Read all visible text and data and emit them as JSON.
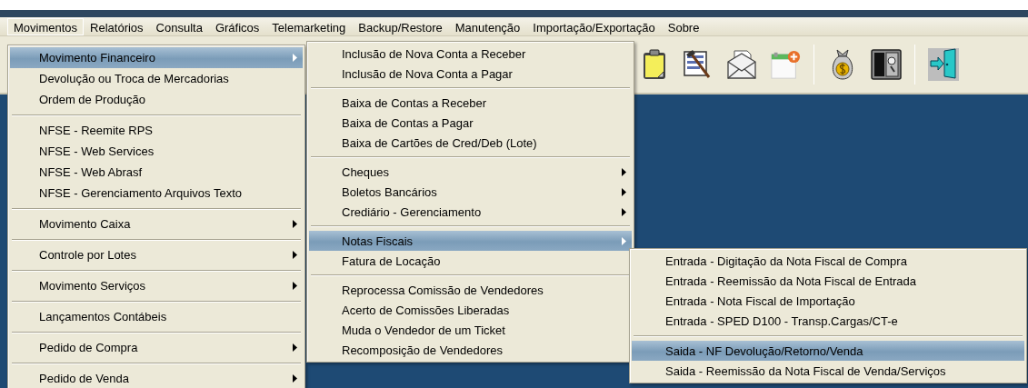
{
  "menubar": [
    {
      "label": "Movimentos",
      "selected": true
    },
    {
      "label": "Relatórios",
      "selected": false
    },
    {
      "label": "Consulta",
      "selected": false
    },
    {
      "label": "Gráficos",
      "selected": false
    },
    {
      "label": "Telemarketing",
      "selected": false
    },
    {
      "label": "Backup/Restore",
      "selected": false
    },
    {
      "label": "Manutenção",
      "selected": false
    },
    {
      "label": "Importação/Exportação",
      "selected": false
    },
    {
      "label": "Sobre",
      "selected": false
    }
  ],
  "toolbar": [
    {
      "kind": "clipboard"
    },
    {
      "kind": "form-edit"
    },
    {
      "kind": "envelope"
    },
    {
      "kind": "calendar-add"
    },
    {
      "kind": "separator"
    },
    {
      "kind": "money-bag"
    },
    {
      "kind": "safe"
    },
    {
      "kind": "separator"
    },
    {
      "kind": "exit"
    }
  ],
  "menus": [
    {
      "items": [
        {
          "kind": "item",
          "label": "Movimento Financeiro",
          "selected": true,
          "submenu": true
        },
        {
          "kind": "item",
          "label": "Devolução ou Troca de Mercadorias",
          "selected": false,
          "submenu": false
        },
        {
          "kind": "item",
          "label": "Ordem de Produção",
          "selected": false,
          "submenu": false
        },
        {
          "kind": "separator"
        },
        {
          "kind": "item",
          "label": "NFSE - Reemite RPS",
          "selected": false,
          "submenu": false
        },
        {
          "kind": "item",
          "label": "NFSE - Web Services",
          "selected": false,
          "submenu": false
        },
        {
          "kind": "item",
          "label": "NFSE - Web Abrasf",
          "selected": false,
          "submenu": false
        },
        {
          "kind": "item",
          "label": "NFSE - Gerenciamento Arquivos Texto",
          "selected": false,
          "submenu": false
        },
        {
          "kind": "separator"
        },
        {
          "kind": "item",
          "label": "Movimento Caixa",
          "selected": false,
          "submenu": true
        },
        {
          "kind": "separator"
        },
        {
          "kind": "item",
          "label": "Controle por Lotes",
          "selected": false,
          "submenu": true
        },
        {
          "kind": "separator"
        },
        {
          "kind": "item",
          "label": "Movimento Serviços",
          "selected": false,
          "submenu": true
        },
        {
          "kind": "separator"
        },
        {
          "kind": "item",
          "label": "Lançamentos Contábeis",
          "selected": false,
          "submenu": false
        },
        {
          "kind": "separator"
        },
        {
          "kind": "item",
          "label": "Pedido de Compra",
          "selected": false,
          "submenu": true
        },
        {
          "kind": "separator"
        },
        {
          "kind": "item",
          "label": "Pedido de Venda",
          "selected": false,
          "submenu": true
        }
      ]
    },
    {
      "items": [
        {
          "kind": "item",
          "label": "Inclusão de Nova Conta a Receber",
          "selected": false,
          "submenu": false
        },
        {
          "kind": "item",
          "label": "Inclusão de Nova Conta a Pagar",
          "selected": false,
          "submenu": false
        },
        {
          "kind": "separator"
        },
        {
          "kind": "item",
          "label": "Baixa de Contas a Receber",
          "selected": false,
          "submenu": false
        },
        {
          "kind": "item",
          "label": "Baixa de Contas a Pagar",
          "selected": false,
          "submenu": false
        },
        {
          "kind": "item",
          "label": "Baixa de Cartões de Cred/Deb (Lote)",
          "selected": false,
          "submenu": false
        },
        {
          "kind": "separator"
        },
        {
          "kind": "item",
          "label": "Cheques",
          "selected": false,
          "submenu": true
        },
        {
          "kind": "item",
          "label": "Boletos Bancários",
          "selected": false,
          "submenu": true
        },
        {
          "kind": "item",
          "label": "Crediário - Gerenciamento",
          "selected": false,
          "submenu": true
        },
        {
          "kind": "separator"
        },
        {
          "kind": "item",
          "label": "Notas Fiscais",
          "selected": true,
          "submenu": true
        },
        {
          "kind": "item",
          "label": "Fatura de Locação",
          "selected": false,
          "submenu": false
        },
        {
          "kind": "separator"
        },
        {
          "kind": "item",
          "label": "Reprocessa Comissão de Vendedores",
          "selected": false,
          "submenu": false
        },
        {
          "kind": "item",
          "label": "Acerto de Comissões Liberadas",
          "selected": false,
          "submenu": false
        },
        {
          "kind": "item",
          "label": "Muda o Vendedor de um Ticket",
          "selected": false,
          "submenu": false
        },
        {
          "kind": "item",
          "label": "Recomposição de Vendedores",
          "selected": false,
          "submenu": false
        }
      ]
    },
    {
      "items": [
        {
          "kind": "item",
          "label": "Entrada - Digitação da Nota Fiscal de Compra",
          "selected": false,
          "submenu": false
        },
        {
          "kind": "item",
          "label": "Entrada - Reemissão da Nota Fiscal de Entrada",
          "selected": false,
          "submenu": false
        },
        {
          "kind": "item",
          "label": "Entrada - Nota Fiscal de Importação",
          "selected": false,
          "submenu": false
        },
        {
          "kind": "item",
          "label": "Entrada - SPED D100 - Transp.Cargas/CT-e",
          "selected": false,
          "submenu": false
        },
        {
          "kind": "separator"
        },
        {
          "kind": "item",
          "label": "Saida - NF Devolução/Retorno/Venda",
          "selected": true,
          "submenu": false
        },
        {
          "kind": "item",
          "label": "Saida - Reemissão da Nota Fiscal de Venda/Serviços",
          "selected": false,
          "submenu": false
        }
      ]
    }
  ]
}
